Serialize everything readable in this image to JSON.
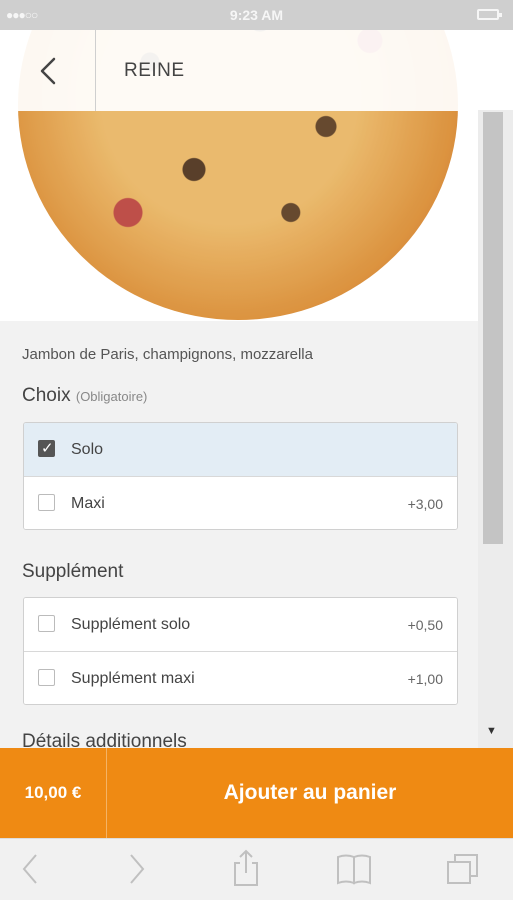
{
  "status_bar": {
    "signal": "●●●○○",
    "time": "9:23 AM"
  },
  "header": {
    "title": "REINE"
  },
  "product": {
    "description": "Jambon de Paris, champignons, mozzarella"
  },
  "choix": {
    "title": "Choix",
    "note": "(Obligatoire)",
    "options": [
      {
        "label": "Solo",
        "price": "",
        "checked": true
      },
      {
        "label": "Maxi",
        "price": "+3,00",
        "checked": false
      }
    ]
  },
  "supplement": {
    "title": "Supplément",
    "options": [
      {
        "label": "Supplément solo",
        "price": "+0,50",
        "checked": false
      },
      {
        "label": "Supplément maxi",
        "price": "+1,00",
        "checked": false
      }
    ]
  },
  "details": {
    "title": "Détails additionnels"
  },
  "cart": {
    "total": "10,00 €",
    "add_label": "Ajouter au panier"
  },
  "colors": {
    "accent": "#ef8a13",
    "selected_row": "#e3edf5",
    "background": "#f2f2f2"
  },
  "icons": [
    "back-chevron-icon",
    "browser-back-icon",
    "browser-forward-icon",
    "share-icon",
    "bookmarks-icon",
    "tabs-icon"
  ]
}
